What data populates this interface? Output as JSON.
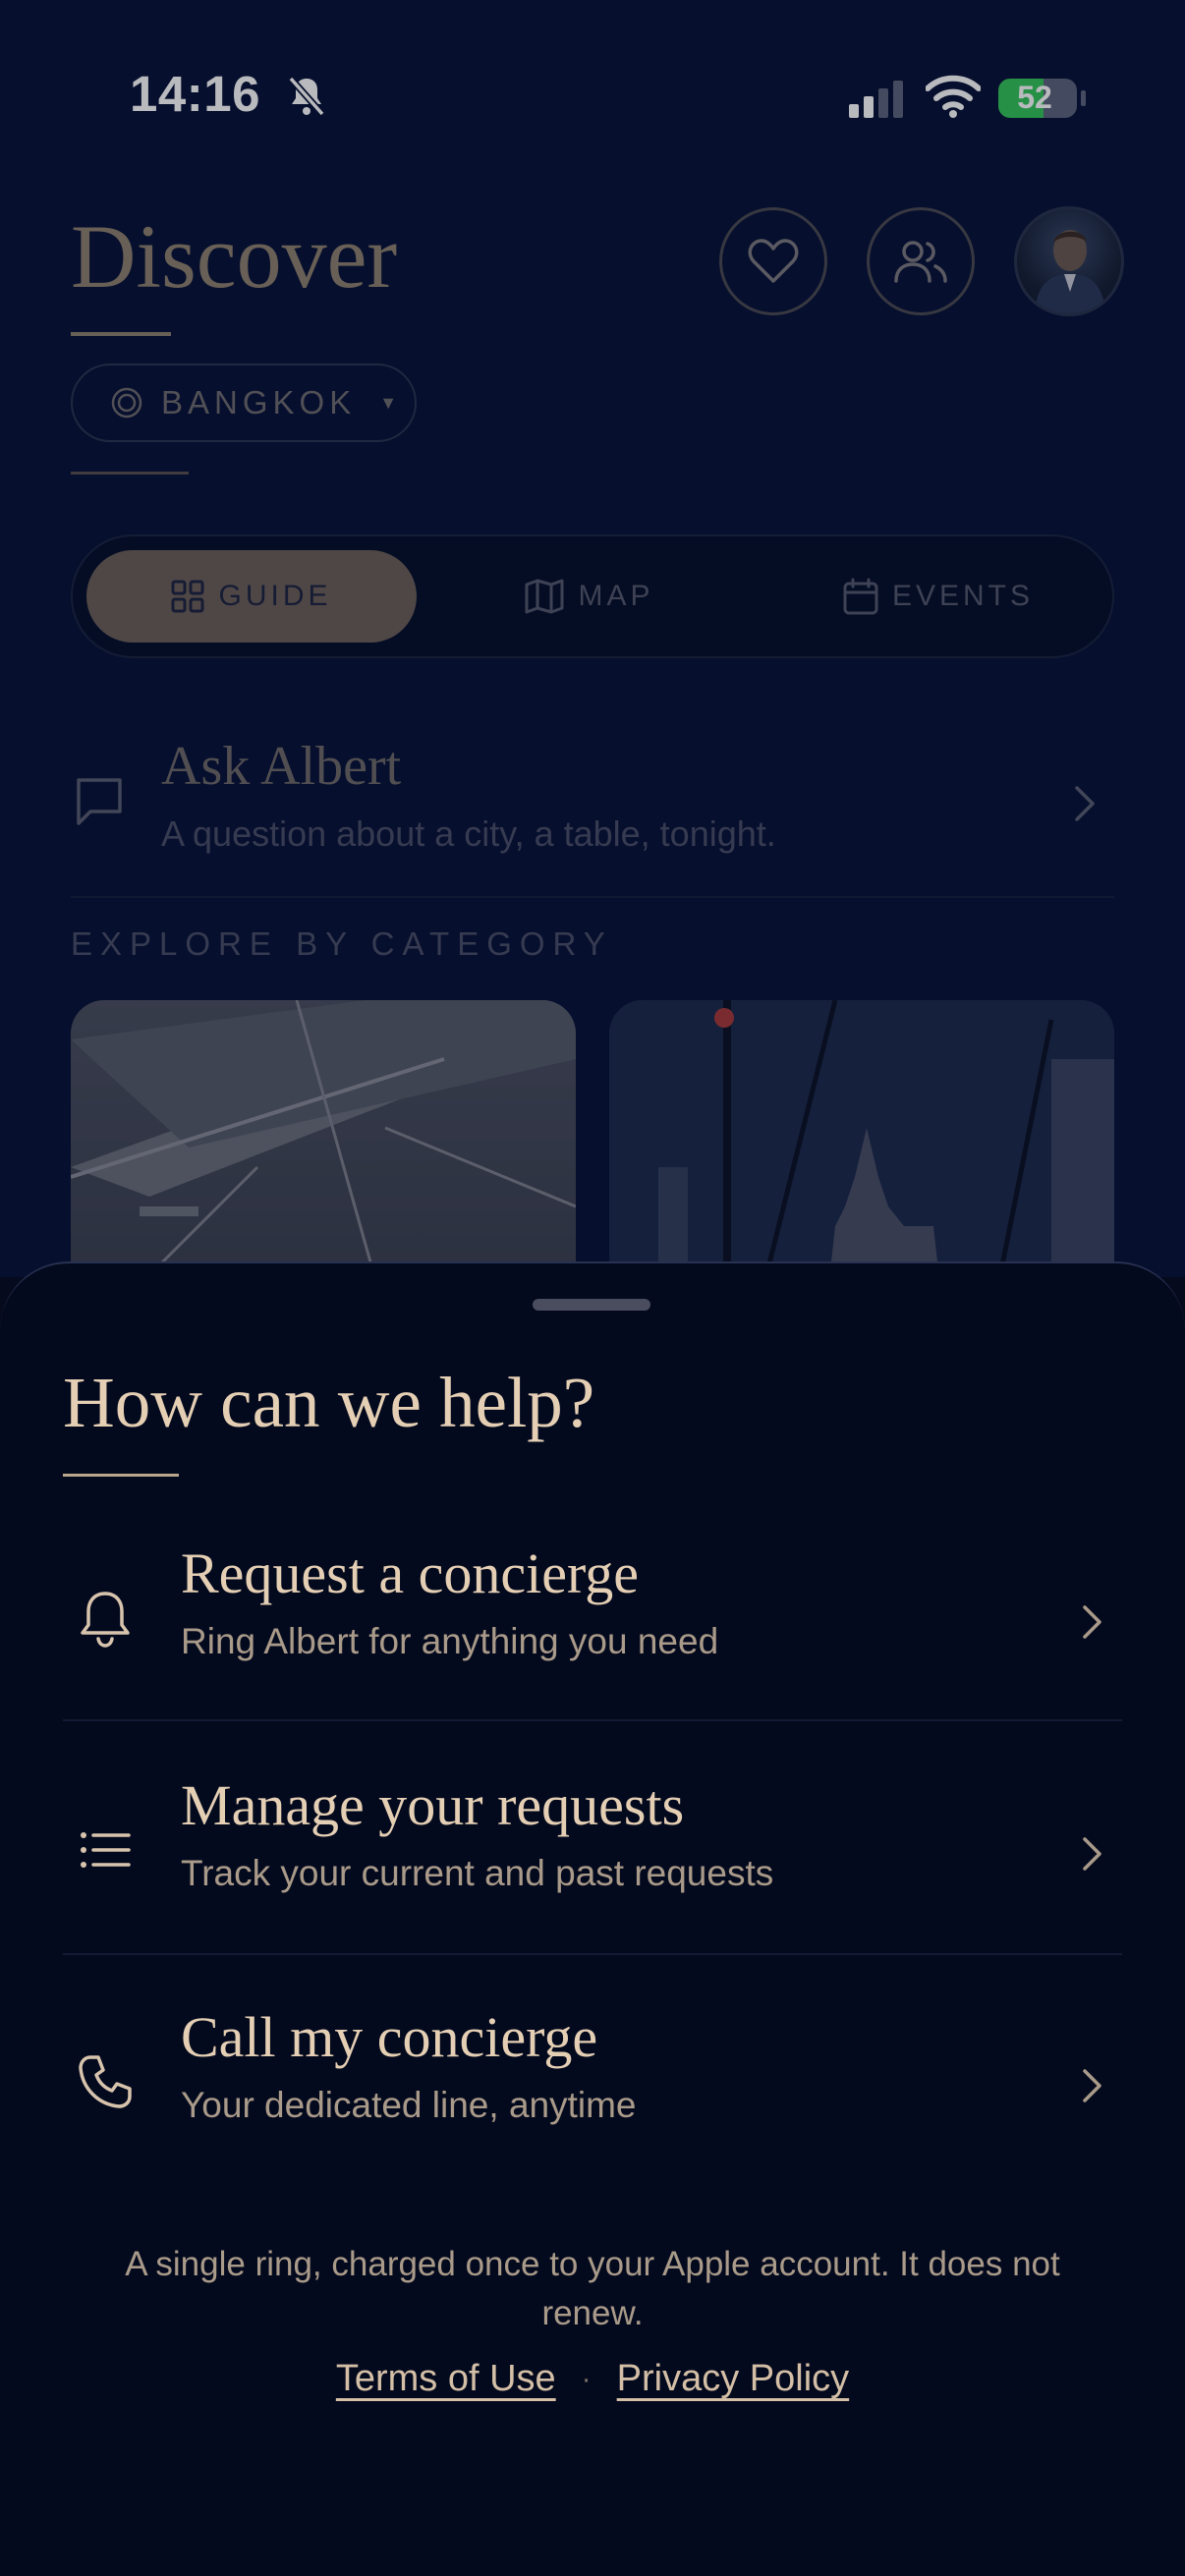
{
  "status_bar": {
    "time": "14:16",
    "battery": "52"
  },
  "header": {
    "title": "Discover",
    "city": "BANGKOK"
  },
  "tabs": [
    {
      "label": "GUIDE",
      "active": true
    },
    {
      "label": "MAP",
      "active": false
    },
    {
      "label": "EVENTS",
      "active": false
    }
  ],
  "ask": {
    "title": "Ask Albert",
    "subtitle": "A question about a city, a table, tonight."
  },
  "explore": {
    "label": "EXPLORE BY CATEGORY"
  },
  "sheet": {
    "title": "How can we help?",
    "options": [
      {
        "title": "Request a concierge",
        "subtitle": "Ring Albert for anything you need",
        "icon": "bell-icon"
      },
      {
        "title": "Manage your requests",
        "subtitle": "Track your current and past requests",
        "icon": "list-icon"
      },
      {
        "title": "Call my concierge",
        "subtitle": "Your dedicated line, anytime",
        "icon": "phone-icon"
      }
    ],
    "footnote": "A single ring, charged once to your Apple account. It does not renew.",
    "terms_label": "Terms of Use",
    "privacy_label": "Privacy Policy",
    "separator": "·"
  },
  "colors": {
    "background": "#050a1d",
    "accent": "#e5cfb4",
    "muted": "#a99a89",
    "battery": "#34c759"
  }
}
